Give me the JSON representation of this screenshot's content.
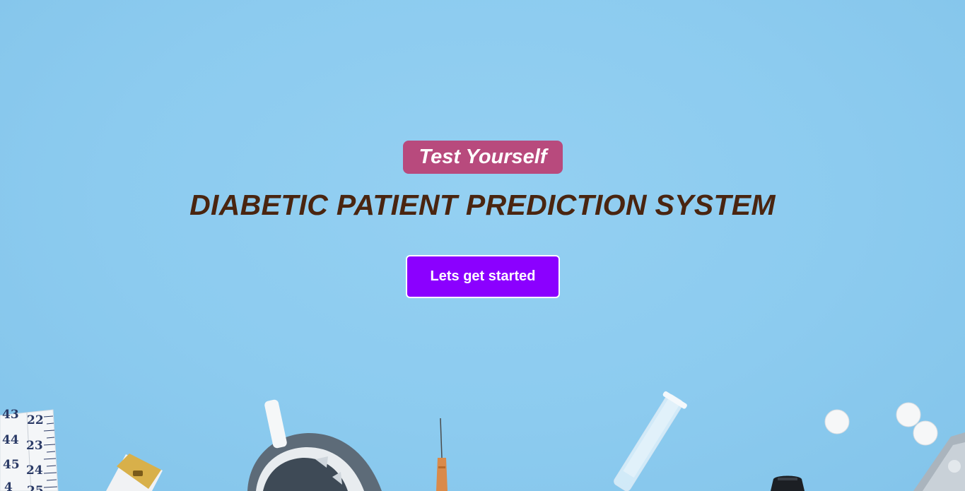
{
  "hero": {
    "tag": "Test Yourself",
    "title": "DIABETIC PATIENT PREDICTION SYSTEM",
    "cta_label": "Lets get started"
  },
  "decor": {
    "tape_numbers": [
      "43",
      "22",
      "44",
      "23",
      "45",
      "24",
      "4",
      "25"
    ]
  },
  "colors": {
    "background": "#8ccbef",
    "tag_bg": "#b84a7d",
    "title_text": "#4a2510",
    "cta_bg": "#8b00ff"
  }
}
